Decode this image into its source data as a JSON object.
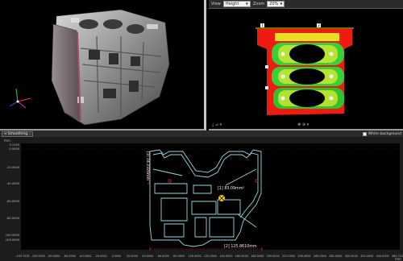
{
  "heatmap_toolbar": {
    "view_label": "View",
    "view_value": "Height",
    "zoom_label": "Zoom",
    "zoom_value": "20%",
    "marker_1": "1",
    "marker_2": "2"
  },
  "heatmap_footer": {
    "left_icons": "⤓ ⊿ ▾",
    "center_icons": "✥ ⊕ ▾"
  },
  "section_toolbar": {
    "smoothing_label": "Smoothing...",
    "white_background_label": "White background"
  },
  "section_plot": {
    "y_unit": "mm",
    "x_unit": "mm",
    "y_ticks": [
      "3.1195",
      "0.0000",
      "-20.0000",
      "-40.0000",
      "-60.0000",
      "-80.0000",
      "-100.0000",
      "-103.0000"
    ],
    "x_ticks": [
      "-195.7235",
      "-100.0000",
      "-80.0000",
      "-60.0000",
      "-40.0000",
      "-20.0000",
      "0.0000",
      "20.0000",
      "40.0000",
      "60.0000",
      "80.0000",
      "100.0000",
      "120.0000",
      "140.0000",
      "160.0000",
      "180.0000",
      "200.0000",
      "220.0000",
      "240.0000",
      "260.0000",
      "280.0000",
      "300.0000",
      "320.0000",
      "340.0000",
      "360.7235"
    ],
    "height_annotation": "[3] 24.2320mm",
    "area_annotation": "[1] 83.09mm²",
    "width_annotation": "[2] 125.8610mm"
  },
  "colors": {
    "section_outline": "#9ad7dd",
    "annotation_red": "#ff3b3b",
    "centroid_marker": "#f2d21c"
  }
}
